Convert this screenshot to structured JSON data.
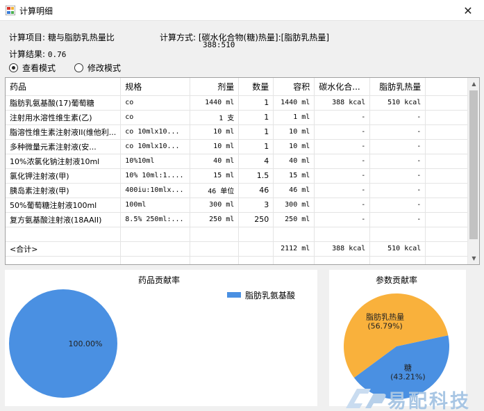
{
  "window": {
    "title": "计算明细"
  },
  "info": {
    "item_label": "计算项目:",
    "item_value": "糖与脂肪乳热量比",
    "method_label": "计算方式:",
    "method_value": "[碳水化合物(糖)热量]:[脂肪乳热量]",
    "method_numbers": "388:510",
    "result_label": "计算结果:",
    "result_value": "0.76"
  },
  "modes": [
    {
      "label": "查看模式",
      "selected": true
    },
    {
      "label": "修改模式",
      "selected": false
    }
  ],
  "table": {
    "columns": [
      "药品",
      "规格",
      "剂量",
      "数量",
      "容积",
      "碳水化合...",
      "脂肪乳热量"
    ],
    "rows": [
      [
        "脂肪乳氨基酸(17)葡萄糖",
        "co",
        "1440 ml",
        "1",
        "1440 ml",
        "388 kcal",
        "510 kcal"
      ],
      [
        "注射用水溶性维生素(乙)",
        "co",
        "1 支",
        "1",
        "1 ml",
        "-",
        "-"
      ],
      [
        "脂溶性维生素注射液II(维他利...",
        "co 10mlx10...",
        "10 ml",
        "1",
        "10 ml",
        "-",
        "-"
      ],
      [
        "多种微量元素注射液(安...",
        "co 10mlx10...",
        "10 ml",
        "1",
        "10 ml",
        "-",
        "-"
      ],
      [
        "10%浓氯化钠注射液10ml",
        "10%10ml",
        "40 ml",
        "4",
        "40 ml",
        "-",
        "-"
      ],
      [
        "氯化钾注射液(甲)",
        "10% 10ml:1....",
        "15 ml",
        "1.5",
        "15 ml",
        "-",
        "-"
      ],
      [
        "胰岛素注射液(甲)",
        "400iu:10mlx...",
        "46 单位",
        "46",
        "46 ml",
        "-",
        "-"
      ],
      [
        "50%葡萄糖注射液100ml",
        "100ml",
        "300 ml",
        "3",
        "300 ml",
        "-",
        "-"
      ],
      [
        "复方氨基酸注射液(18AAII)",
        "8.5% 250ml:...",
        "250 ml",
        "250",
        "250 ml",
        "-",
        "-"
      ]
    ],
    "total_row": [
      "<合计>",
      "",
      "",
      "",
      "2112 ml",
      "388 kcal",
      "510 kcal"
    ]
  },
  "drug_chart": {
    "title": "药品贡献率",
    "chart_data": {
      "type": "pie",
      "title": "药品贡献率",
      "slices": [
        {
          "label": "脂肪乳氨基酸",
          "value": 100.0,
          "display": "100.00%",
          "color": "#4a90e2"
        }
      ],
      "legend": "top-right"
    }
  },
  "param_chart": {
    "title": "参数贡献率",
    "chart_data": {
      "type": "pie",
      "title": "参数贡献率",
      "slices": [
        {
          "label": "糖",
          "value": 43.21,
          "display": "(43.21%)",
          "color": "#4a90e2"
        },
        {
          "label": "脂肪乳热量",
          "value": 56.79,
          "display": "(56.79%)",
          "color": "#f9b13c"
        }
      ]
    }
  },
  "watermark": {
    "text": "易配科技"
  }
}
